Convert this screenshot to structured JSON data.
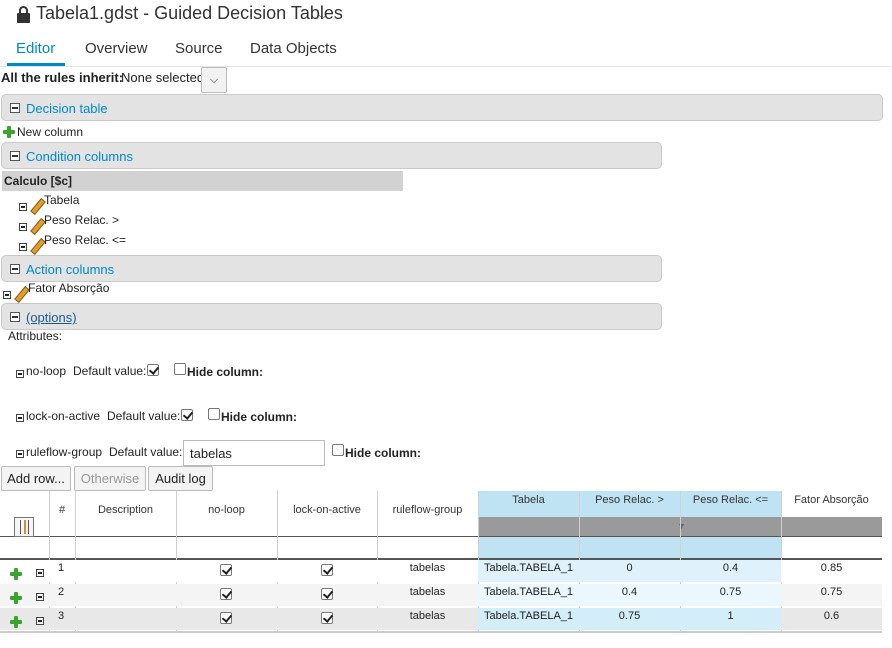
{
  "header": {
    "title": "Tabela1.gdst - Guided Decision Tables"
  },
  "tabs": [
    {
      "label": "Editor",
      "active": true
    },
    {
      "label": "Overview"
    },
    {
      "label": "Source"
    },
    {
      "label": "Data Objects"
    }
  ],
  "inherit": {
    "label": "All the rules inherit:",
    "value": "None selected"
  },
  "sections": {
    "decision_table": "Decision table",
    "new_column": "New column",
    "condition_columns": "Condition columns",
    "action_columns": "Action columns",
    "options": "(options)"
  },
  "pattern": {
    "name": "Calculo [$c]",
    "conditions": [
      "Tabela",
      "Peso Relac. >",
      "Peso Relac. <="
    ]
  },
  "actions": [
    "Fator Absorção"
  ],
  "attributes": {
    "label": "Attributes:",
    "default_value_label": "Default value:",
    "hide_column_label": "Hide column:",
    "items": [
      {
        "name": "no-loop",
        "default_checked": true,
        "hide": false
      },
      {
        "name": "lock-on-active",
        "default_checked": true,
        "hide": false
      },
      {
        "name": "ruleflow-group",
        "default_text": "tabelas",
        "hide": false
      }
    ]
  },
  "toolbar": {
    "add_row": "Add row...",
    "otherwise": "Otherwise",
    "audit_log": "Audit log"
  },
  "grid": {
    "headers": [
      "#",
      "Description",
      "no-loop",
      "lock-on-active",
      "ruleflow-group",
      "Tabela",
      "Peso Relac. >",
      "Peso Relac. <=",
      "Fator Absorção"
    ],
    "rows": [
      {
        "num": "1",
        "description": "",
        "no_loop": true,
        "lock_on_active": true,
        "ruleflow_group": "tabelas",
        "tabela": "Tabela.TABELA_1",
        "peso_gt": "0",
        "peso_le": "0.4",
        "fator": "0.85"
      },
      {
        "num": "2",
        "description": "",
        "no_loop": true,
        "lock_on_active": true,
        "ruleflow_group": "tabelas",
        "tabela": "Tabela.TABELA_1",
        "peso_gt": "0.4",
        "peso_le": "0.75",
        "fator": "0.75"
      },
      {
        "num": "3",
        "description": "",
        "no_loop": true,
        "lock_on_active": true,
        "ruleflow_group": "tabelas",
        "tabela": "Tabela.TABELA_1",
        "peso_gt": "0.75",
        "peso_le": "1",
        "fator": "0.6"
      }
    ]
  },
  "colors": {
    "accent": "#0088ce",
    "condition_header": "#bfe3f2",
    "condition_cell": "#dff2fb"
  }
}
